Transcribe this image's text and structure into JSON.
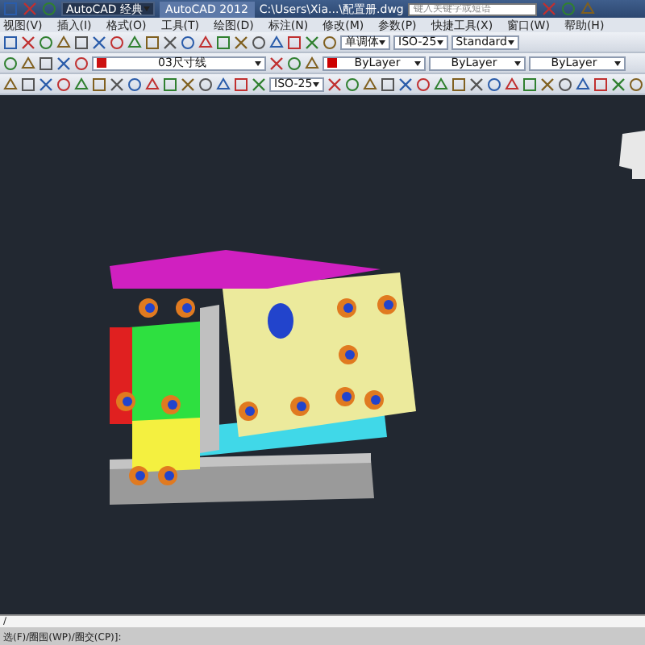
{
  "title_bar": {
    "workspace": "AutoCAD 经典",
    "app": "AutoCAD 2012",
    "file": "C:\\Users\\Xia...\\配置册.dwg",
    "search": {
      "placeholder": "键入关键字或短语"
    }
  },
  "menu": [
    "视图(V)",
    "插入(I)",
    "格式(O)",
    "工具(T)",
    "绘图(D)",
    "标注(N)",
    "修改(M)",
    "参数(P)",
    "快捷工具(X)",
    "窗口(W)",
    "帮助(H)"
  ],
  "styles_toolbar": {
    "text_style": "单调体",
    "dim_style": "ISO-25",
    "table_style": "Standard"
  },
  "layers_toolbar": {
    "layer": "03尺寸线",
    "color_setting": "ByLayer",
    "linetype": "ByLayer",
    "lineweight": "ByLayer"
  },
  "dim_toolbar": {
    "dim_style": "ISO-25"
  },
  "command_line": {
    "prompt": "/",
    "history": "选(F)/圈围(WP)/圈交(CP)]:"
  }
}
